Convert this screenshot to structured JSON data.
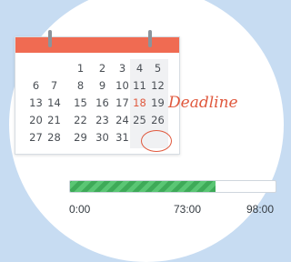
{
  "calendar": {
    "weeks": [
      [
        "",
        "",
        "1",
        "2",
        "3",
        "4",
        "5"
      ],
      [
        "6",
        "7",
        "8",
        "9",
        "10",
        "11",
        "12"
      ],
      [
        "13",
        "14",
        "15",
        "16",
        "17",
        "18",
        "19"
      ],
      [
        "20",
        "21",
        "22",
        "23",
        "24",
        "25",
        "26"
      ],
      [
        "27",
        "28",
        "29",
        "30",
        "31",
        "",
        ""
      ]
    ],
    "highlighted_day": "18"
  },
  "deadline": {
    "label": "Deadline"
  },
  "progress": {
    "fill_fraction": 0.71,
    "start_label": "0:00",
    "current_label": "73:00",
    "end_label": "98:00",
    "fill_color": "#4cb866",
    "accent_color": "#e0593e"
  }
}
